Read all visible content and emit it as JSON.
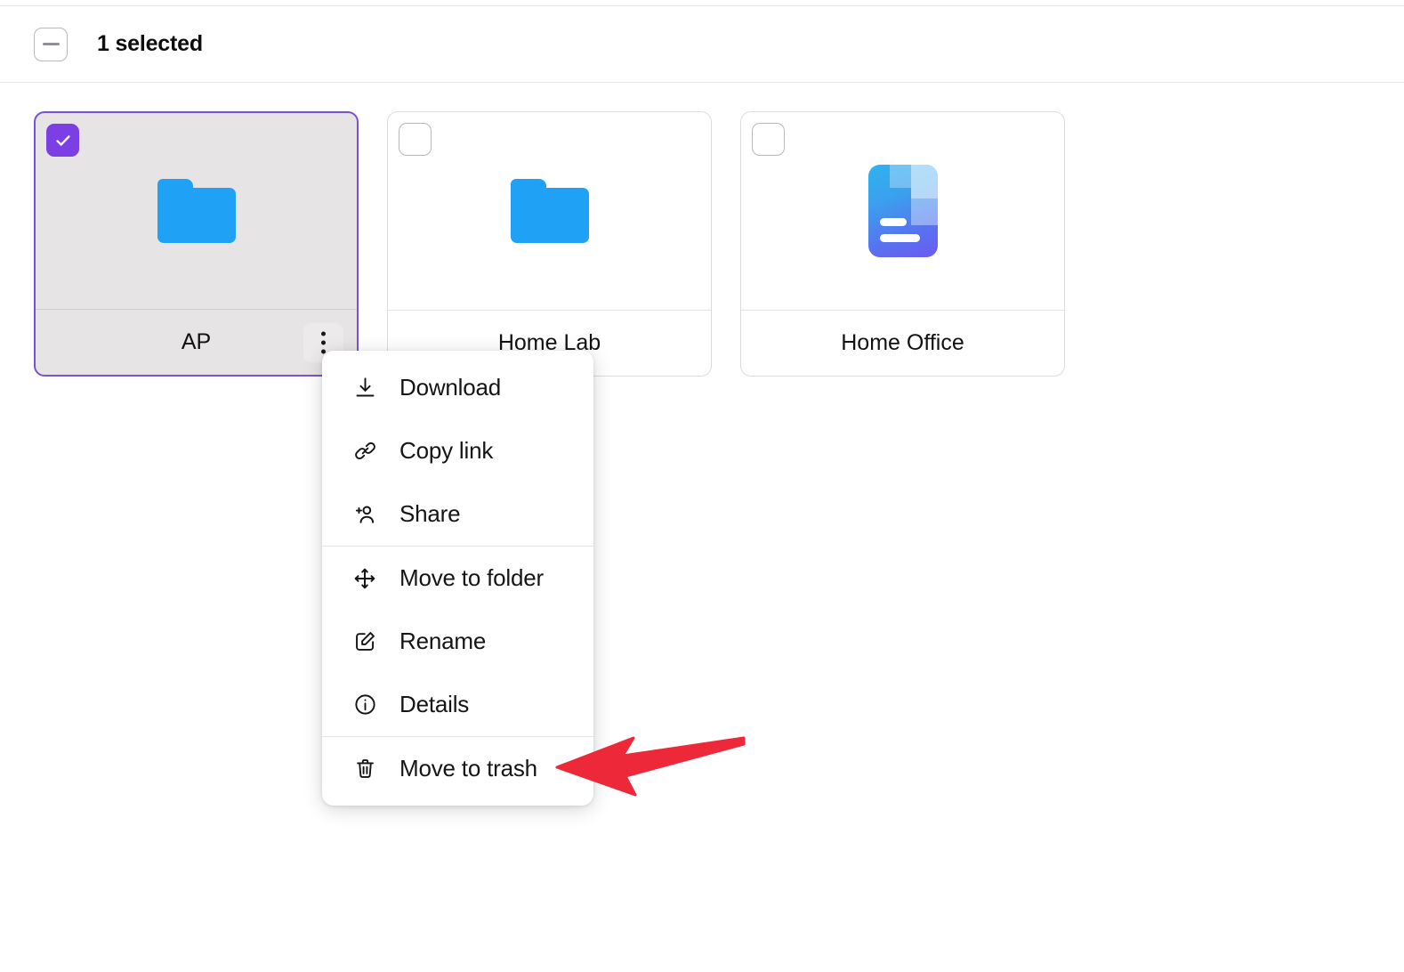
{
  "toolbar": {
    "select_all_checkbox": "indeterminate-checkbox",
    "selection_label": "1 selected"
  },
  "items": [
    {
      "name": "AP",
      "type": "folder",
      "icon": "folder-icon",
      "selected": true,
      "checkbox_state": "checked",
      "has_kebab": true,
      "kebab_icon": "kebab-menu-icon"
    },
    {
      "name": "Home Lab",
      "type": "folder",
      "icon": "folder-icon",
      "selected": false,
      "checkbox_state": "unchecked",
      "has_kebab": false
    },
    {
      "name": "Home Office",
      "type": "document",
      "icon": "document-icon",
      "selected": false,
      "checkbox_state": "unchecked",
      "has_kebab": false
    }
  ],
  "context_menu": {
    "groups": [
      {
        "items": [
          {
            "label": "Download",
            "icon": "download-icon"
          },
          {
            "label": "Copy link",
            "icon": "link-icon"
          },
          {
            "label": "Share",
            "icon": "person-add-icon"
          }
        ]
      },
      {
        "items": [
          {
            "label": "Move to folder",
            "icon": "move-arrows-icon"
          },
          {
            "label": "Rename",
            "icon": "pencil-square-icon"
          },
          {
            "label": "Details",
            "icon": "info-circle-icon"
          }
        ]
      },
      {
        "items": [
          {
            "label": "Move to trash",
            "icon": "trash-icon"
          }
        ]
      }
    ]
  },
  "annotation": {
    "type": "arrow",
    "color": "#ed2939",
    "points_to": "Move to trash"
  },
  "colors": {
    "accent_purple": "#7c3fe4",
    "selected_border": "#7b52d3",
    "folder_blue": "#1fa2f5",
    "annotation_red": "#ed2939",
    "card_border": "#dcdcde",
    "selected_card_bg": "#e6e4e4"
  }
}
